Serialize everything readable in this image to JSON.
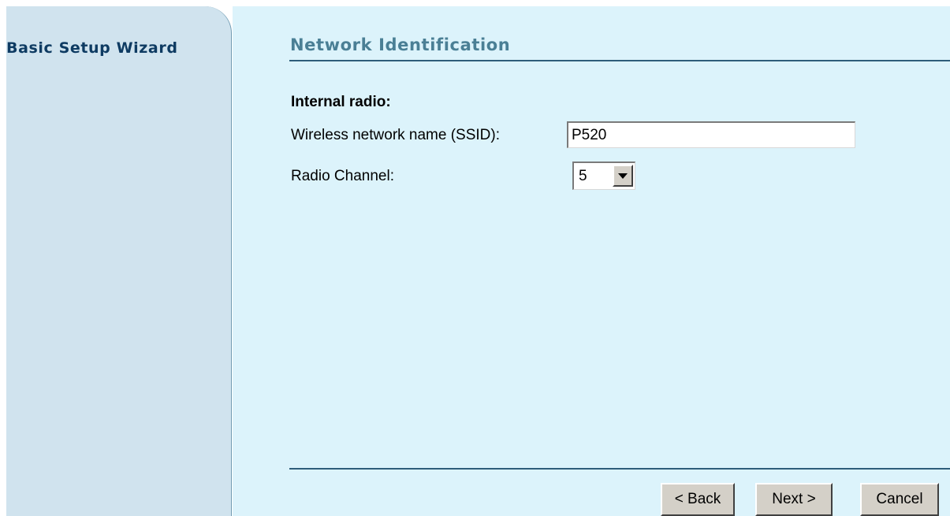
{
  "sidebar": {
    "title": "Basic Setup Wizard"
  },
  "main": {
    "title": "Network Identification",
    "section_label": "Internal radio:",
    "ssid": {
      "label": "Wireless network name (SSID):",
      "value": "P520"
    },
    "channel": {
      "label": "Radio Channel:",
      "selected": "5"
    }
  },
  "buttons": {
    "back": "< Back",
    "next": "Next >",
    "cancel": "Cancel"
  },
  "colors": {
    "sidebar_bg": "#d0e3ee",
    "main_bg": "#dcf3fb",
    "title_color": "#4a7f95",
    "sidebar_title_color": "#0e3b62",
    "rule_color": "#2e5d7a"
  },
  "icons": {
    "dropdown": "chevron-down-icon"
  }
}
